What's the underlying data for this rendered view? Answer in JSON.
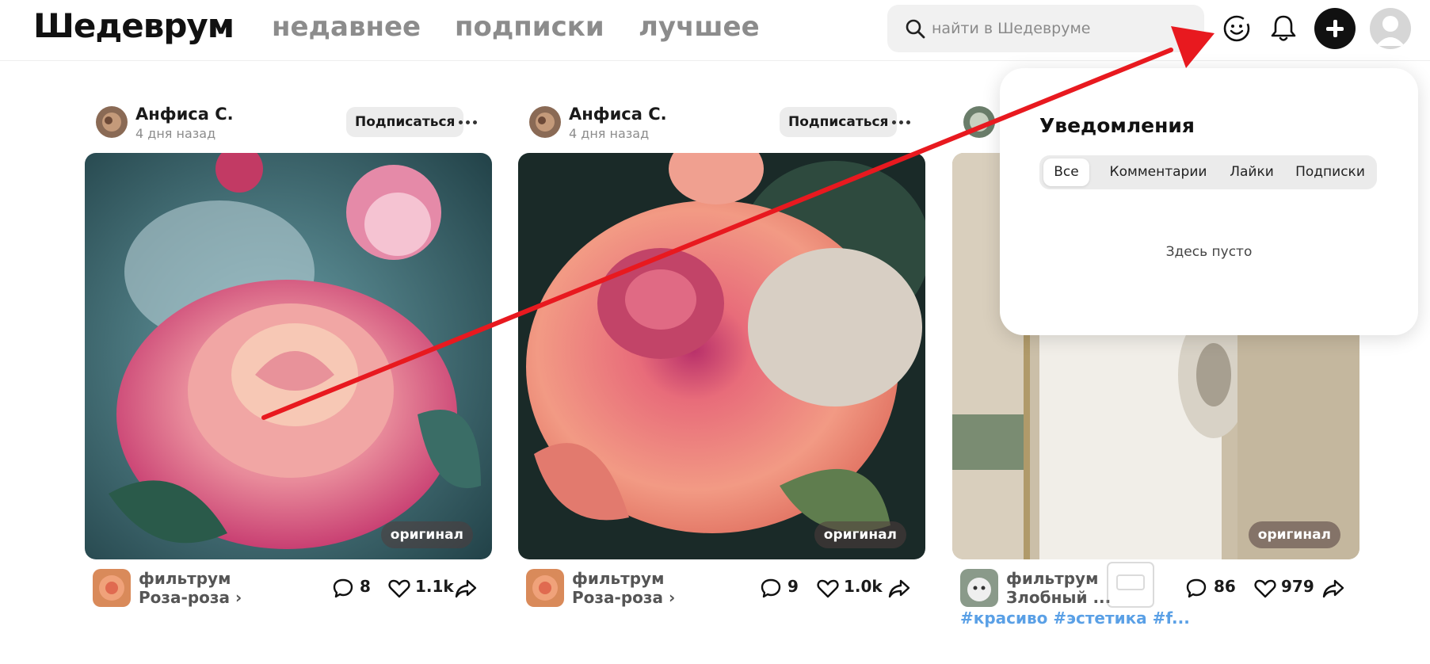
{
  "header": {
    "logo": "Шедеврум",
    "tabs": [
      {
        "label": "недавнее"
      },
      {
        "label": "подписки"
      },
      {
        "label": "лучшее"
      }
    ],
    "search": {
      "placeholder": "найти в Шедевруме"
    }
  },
  "cards": [
    {
      "author": "Анфиса С.",
      "time": "4 дня назад",
      "subscribe_label": "Подписаться",
      "badge": "оригинал",
      "filter_label": "фильтрум",
      "filter_name": "Роза-роза ›",
      "comments": "8",
      "likes": "1.1k"
    },
    {
      "author": "Анфиса С.",
      "time": "4 дня назад",
      "subscribe_label": "Подписаться",
      "badge": "оригинал",
      "filter_label": "фильтрум",
      "filter_name": "Роза-роза ›",
      "comments": "9",
      "likes": "1.0k"
    },
    {
      "badge": "оригинал",
      "filter_label": "фильтрум",
      "filter_name": "Злобный ...",
      "comments": "86",
      "likes": "979",
      "tags": "#красиво #эстетика #f..."
    }
  ],
  "notifications": {
    "title": "Уведомления",
    "tabs": [
      {
        "label": "Все"
      },
      {
        "label": "Комментарии"
      },
      {
        "label": "Лайки"
      },
      {
        "label": "Подписки"
      }
    ],
    "active_tab": "Все",
    "empty_text": "Здесь пусто"
  },
  "colors": {
    "arrow": "#e8191f",
    "tags": "#5aa0e6"
  }
}
